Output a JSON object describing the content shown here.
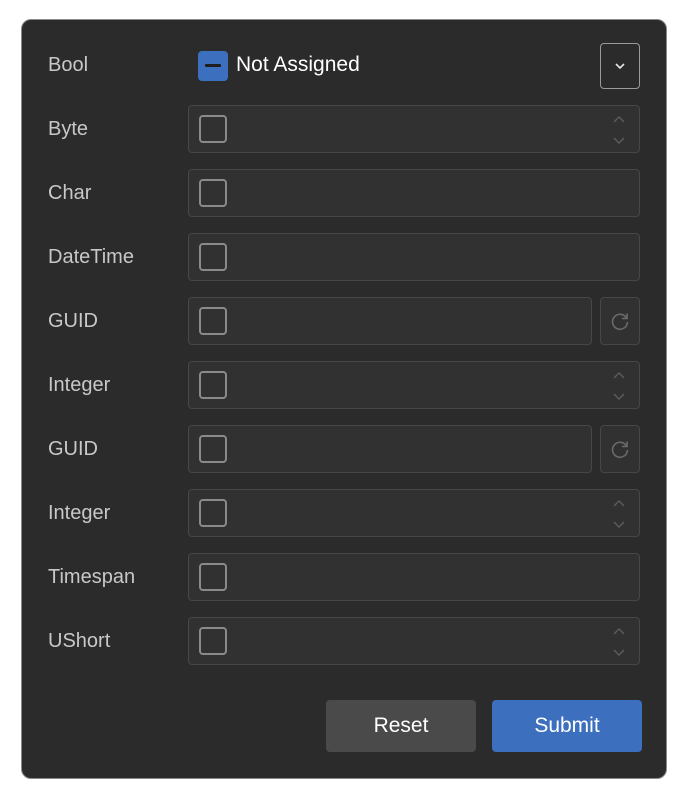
{
  "form": {
    "bool": {
      "label": "Bool",
      "state_text": "Not Assigned"
    },
    "fields": [
      {
        "label": "Byte",
        "kind": "spinner"
      },
      {
        "label": "Char",
        "kind": "plain"
      },
      {
        "label": "DateTime",
        "kind": "plain"
      },
      {
        "label": "GUID",
        "kind": "refresh"
      },
      {
        "label": "Integer",
        "kind": "spinner"
      },
      {
        "label": "GUID",
        "kind": "refresh"
      },
      {
        "label": "Integer",
        "kind": "spinner"
      },
      {
        "label": "Timespan",
        "kind": "plain"
      },
      {
        "label": "UShort",
        "kind": "spinner"
      }
    ]
  },
  "actions": {
    "reset_label": "Reset",
    "submit_label": "Submit"
  },
  "colors": {
    "panel_bg": "#2b2b2b",
    "accent": "#3d6fbf",
    "field_bg": "#313131"
  }
}
